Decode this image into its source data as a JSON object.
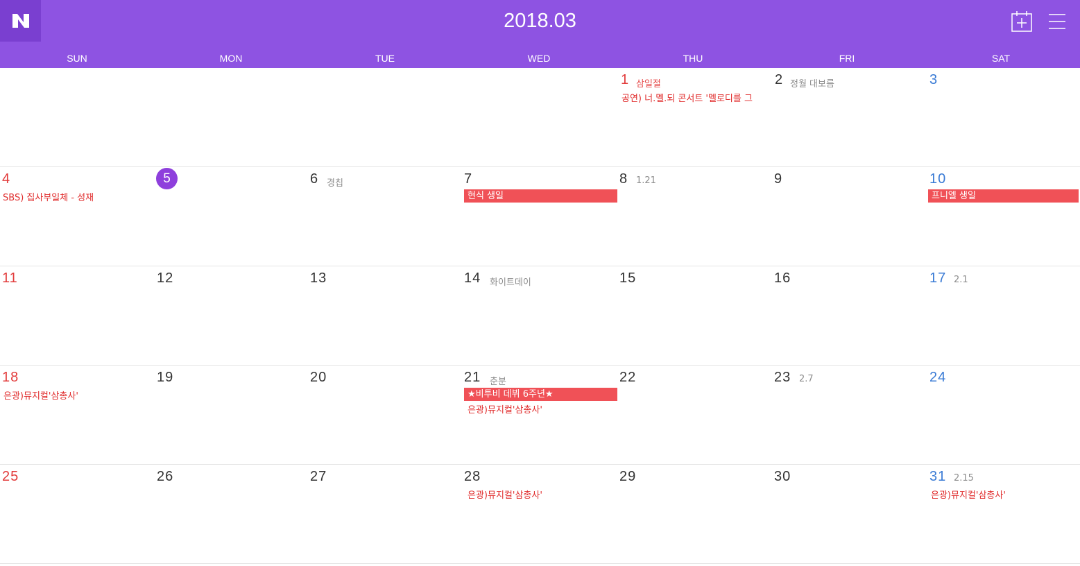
{
  "app": {
    "logo": "N",
    "month_title": "2018.03"
  },
  "colors": {
    "header_bg": "#8e53e2",
    "logo_bg": "#7a3fd0",
    "today_circle": "#8e3fdc",
    "sunday_red": "#e23b3b",
    "saturday_blue": "#3a7bd5",
    "event_bar": "#f05157",
    "event_text": "#e02b2b"
  },
  "icons": {
    "add": "calendar-add-icon",
    "menu": "hamburger-menu-icon"
  },
  "weekdays": [
    "SUN",
    "MON",
    "TUE",
    "WED",
    "THU",
    "FRI",
    "SAT"
  ],
  "days": {
    "d1": "1",
    "d1_sub": "삼일절",
    "d2": "2",
    "d2_sub": "정월 대보름",
    "d3": "3",
    "d4": "4",
    "d5": "5",
    "d6": "6",
    "d6_sub": "경칩",
    "d7": "7",
    "d8": "8",
    "d8_sub": "1.21",
    "d9": "9",
    "d10": "10",
    "d11": "11",
    "d12": "12",
    "d13": "13",
    "d14": "14",
    "d14_sub": "화이트데이",
    "d15": "15",
    "d16": "16",
    "d17": "17",
    "d17_sub": "2.1",
    "d18": "18",
    "d19": "19",
    "d20": "20",
    "d21": "21",
    "d21_sub": "춘분",
    "d22": "22",
    "d23": "23",
    "d23_sub": "2.7",
    "d24": "24",
    "d25": "25",
    "d26": "26",
    "d27": "27",
    "d28": "28",
    "d29": "29",
    "d30": "30",
    "d31": "31",
    "d31_sub": "2.15"
  },
  "events": {
    "e_mar1": "공연) 너.멜.되 콘서트 '멜로디를 그",
    "e_mar4": "SBS) 집사부일체 - 성재",
    "e_mar7": "현식 생일",
    "e_mar10": "프니엘 생일",
    "e_mar18": "은광)뮤지컬'삼총사'",
    "e_mar21_bar": "★비투비 데뷔 6주년★",
    "e_mar21": "은광)뮤지컬'삼총사'",
    "e_mar28": "은광)뮤지컬'삼총사'",
    "e_mar31": "은광)뮤지컬'삼총사'"
  }
}
